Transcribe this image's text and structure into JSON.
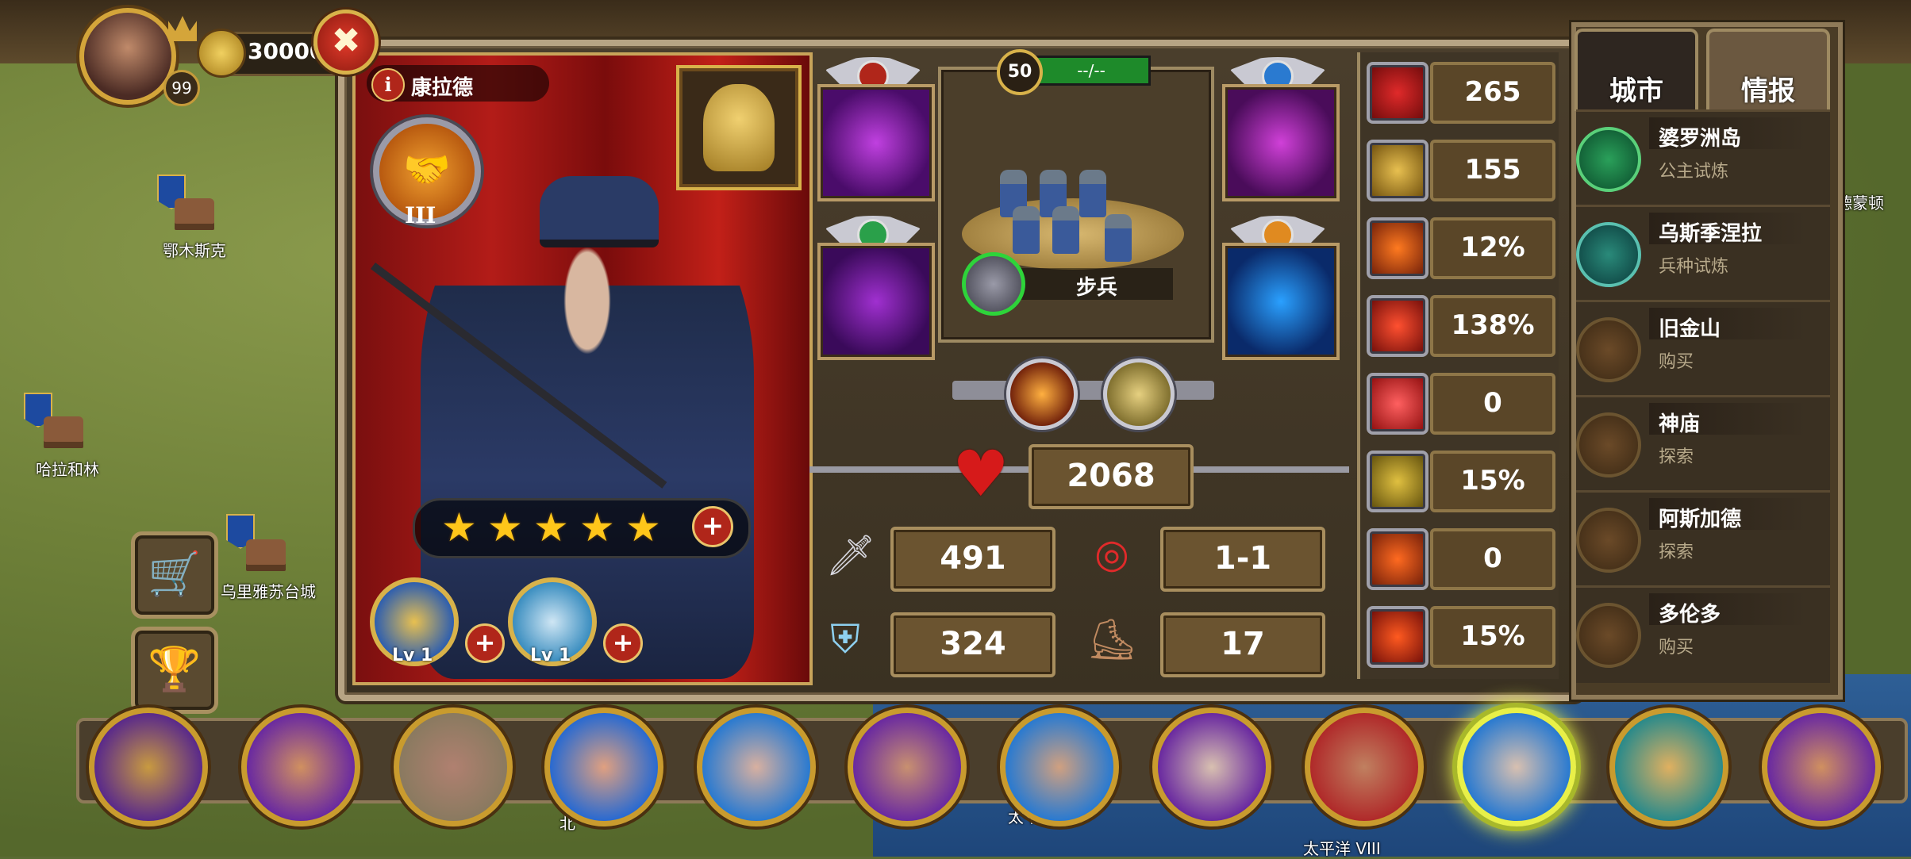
{
  "player": {
    "level": "99",
    "coins": "30000"
  },
  "map": {
    "labels": [
      "鄂木斯克",
      "哈拉和林",
      "乌里雅苏台城",
      "北",
      "太平洋",
      "太平洋 VIII",
      "德蒙顿"
    ]
  },
  "hero": {
    "name": "康拉德",
    "info_icon": "i",
    "rank": "III",
    "stars": 5,
    "skills": [
      {
        "name": "troop-skill",
        "level": "Lv 1"
      },
      {
        "name": "shield-skill",
        "level": "Lv 1"
      }
    ]
  },
  "troop": {
    "level": "50",
    "bar_text": "--/--",
    "name": "步兵"
  },
  "stats": {
    "hp": "2068",
    "attack": "491",
    "defense": "324",
    "range": "1-1",
    "speed": "17"
  },
  "right_stats": [
    "265",
    "155",
    "12%",
    "138%",
    "0",
    "15%",
    "0",
    "15%"
  ],
  "tabs": {
    "city": "城市",
    "intel": "情报"
  },
  "cities": [
    {
      "name": "婆罗洲岛",
      "sub": "公主试炼"
    },
    {
      "name": "乌斯季涅拉",
      "sub": "兵种试炼"
    },
    {
      "name": "旧金山",
      "sub": "购买"
    },
    {
      "name": "神庙",
      "sub": "探索"
    },
    {
      "name": "阿斯加德",
      "sub": "探索"
    },
    {
      "name": "多伦多",
      "sub": "购买"
    }
  ],
  "icons": {
    "close": "✖",
    "plus": "+",
    "star": "★",
    "heart": "♥",
    "sword": "🗡",
    "shield": "⛨",
    "target": "◎",
    "boot": "⛸",
    "cart": "🛒",
    "trophy": "🏆"
  },
  "colors": {
    "gold": "#d8b24a",
    "selected_glow": "#e8f048",
    "hp_red": "#d61a1a"
  }
}
